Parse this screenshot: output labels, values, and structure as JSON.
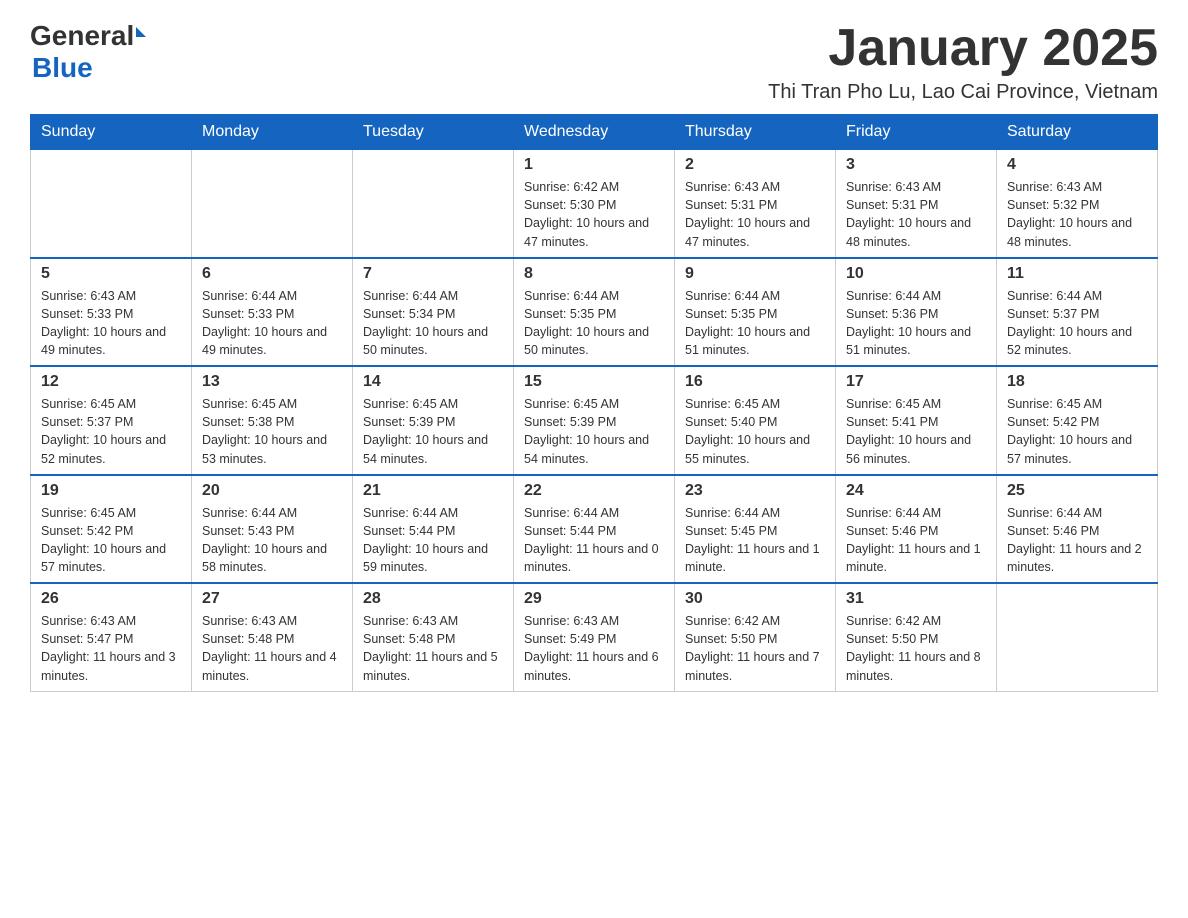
{
  "header": {
    "logo": {
      "general": "General",
      "blue": "Blue"
    },
    "title": "January 2025",
    "location": "Thi Tran Pho Lu, Lao Cai Province, Vietnam"
  },
  "weekdays": [
    "Sunday",
    "Monday",
    "Tuesday",
    "Wednesday",
    "Thursday",
    "Friday",
    "Saturday"
  ],
  "weeks": [
    [
      {
        "day": "",
        "info": ""
      },
      {
        "day": "",
        "info": ""
      },
      {
        "day": "",
        "info": ""
      },
      {
        "day": "1",
        "info": "Sunrise: 6:42 AM\nSunset: 5:30 PM\nDaylight: 10 hours and 47 minutes."
      },
      {
        "day": "2",
        "info": "Sunrise: 6:43 AM\nSunset: 5:31 PM\nDaylight: 10 hours and 47 minutes."
      },
      {
        "day": "3",
        "info": "Sunrise: 6:43 AM\nSunset: 5:31 PM\nDaylight: 10 hours and 48 minutes."
      },
      {
        "day": "4",
        "info": "Sunrise: 6:43 AM\nSunset: 5:32 PM\nDaylight: 10 hours and 48 minutes."
      }
    ],
    [
      {
        "day": "5",
        "info": "Sunrise: 6:43 AM\nSunset: 5:33 PM\nDaylight: 10 hours and 49 minutes."
      },
      {
        "day": "6",
        "info": "Sunrise: 6:44 AM\nSunset: 5:33 PM\nDaylight: 10 hours and 49 minutes."
      },
      {
        "day": "7",
        "info": "Sunrise: 6:44 AM\nSunset: 5:34 PM\nDaylight: 10 hours and 50 minutes."
      },
      {
        "day": "8",
        "info": "Sunrise: 6:44 AM\nSunset: 5:35 PM\nDaylight: 10 hours and 50 minutes."
      },
      {
        "day": "9",
        "info": "Sunrise: 6:44 AM\nSunset: 5:35 PM\nDaylight: 10 hours and 51 minutes."
      },
      {
        "day": "10",
        "info": "Sunrise: 6:44 AM\nSunset: 5:36 PM\nDaylight: 10 hours and 51 minutes."
      },
      {
        "day": "11",
        "info": "Sunrise: 6:44 AM\nSunset: 5:37 PM\nDaylight: 10 hours and 52 minutes."
      }
    ],
    [
      {
        "day": "12",
        "info": "Sunrise: 6:45 AM\nSunset: 5:37 PM\nDaylight: 10 hours and 52 minutes."
      },
      {
        "day": "13",
        "info": "Sunrise: 6:45 AM\nSunset: 5:38 PM\nDaylight: 10 hours and 53 minutes."
      },
      {
        "day": "14",
        "info": "Sunrise: 6:45 AM\nSunset: 5:39 PM\nDaylight: 10 hours and 54 minutes."
      },
      {
        "day": "15",
        "info": "Sunrise: 6:45 AM\nSunset: 5:39 PM\nDaylight: 10 hours and 54 minutes."
      },
      {
        "day": "16",
        "info": "Sunrise: 6:45 AM\nSunset: 5:40 PM\nDaylight: 10 hours and 55 minutes."
      },
      {
        "day": "17",
        "info": "Sunrise: 6:45 AM\nSunset: 5:41 PM\nDaylight: 10 hours and 56 minutes."
      },
      {
        "day": "18",
        "info": "Sunrise: 6:45 AM\nSunset: 5:42 PM\nDaylight: 10 hours and 57 minutes."
      }
    ],
    [
      {
        "day": "19",
        "info": "Sunrise: 6:45 AM\nSunset: 5:42 PM\nDaylight: 10 hours and 57 minutes."
      },
      {
        "day": "20",
        "info": "Sunrise: 6:44 AM\nSunset: 5:43 PM\nDaylight: 10 hours and 58 minutes."
      },
      {
        "day": "21",
        "info": "Sunrise: 6:44 AM\nSunset: 5:44 PM\nDaylight: 10 hours and 59 minutes."
      },
      {
        "day": "22",
        "info": "Sunrise: 6:44 AM\nSunset: 5:44 PM\nDaylight: 11 hours and 0 minutes."
      },
      {
        "day": "23",
        "info": "Sunrise: 6:44 AM\nSunset: 5:45 PM\nDaylight: 11 hours and 1 minute."
      },
      {
        "day": "24",
        "info": "Sunrise: 6:44 AM\nSunset: 5:46 PM\nDaylight: 11 hours and 1 minute."
      },
      {
        "day": "25",
        "info": "Sunrise: 6:44 AM\nSunset: 5:46 PM\nDaylight: 11 hours and 2 minutes."
      }
    ],
    [
      {
        "day": "26",
        "info": "Sunrise: 6:43 AM\nSunset: 5:47 PM\nDaylight: 11 hours and 3 minutes."
      },
      {
        "day": "27",
        "info": "Sunrise: 6:43 AM\nSunset: 5:48 PM\nDaylight: 11 hours and 4 minutes."
      },
      {
        "day": "28",
        "info": "Sunrise: 6:43 AM\nSunset: 5:48 PM\nDaylight: 11 hours and 5 minutes."
      },
      {
        "day": "29",
        "info": "Sunrise: 6:43 AM\nSunset: 5:49 PM\nDaylight: 11 hours and 6 minutes."
      },
      {
        "day": "30",
        "info": "Sunrise: 6:42 AM\nSunset: 5:50 PM\nDaylight: 11 hours and 7 minutes."
      },
      {
        "day": "31",
        "info": "Sunrise: 6:42 AM\nSunset: 5:50 PM\nDaylight: 11 hours and 8 minutes."
      },
      {
        "day": "",
        "info": ""
      }
    ]
  ]
}
